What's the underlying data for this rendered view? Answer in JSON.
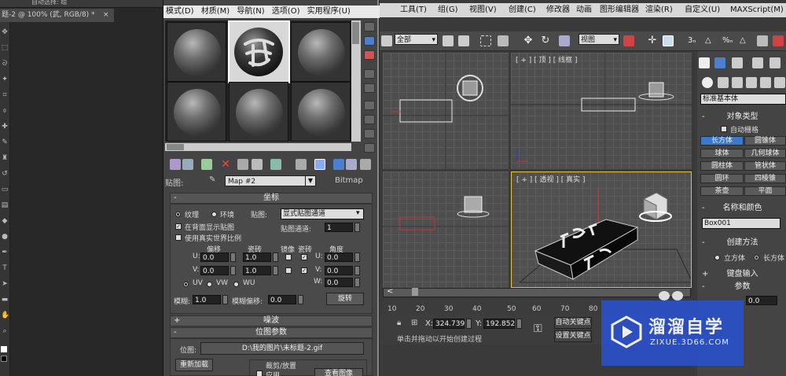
{
  "photoshop": {
    "top_text": "自动选择:  组",
    "tab_title": "题-2 @ 100% (武, RGB/8) *",
    "tab_close": "×"
  },
  "material_editor": {
    "menu": [
      "模式(D)",
      "材质(M)",
      "导航(N)",
      "选项(O)",
      "实用程序(U)"
    ],
    "map_label": "贴图:",
    "map_name": "Map #2",
    "map_type": "Bitmap",
    "rollout_coords": "坐标",
    "texture_label": "纹理",
    "environ_label": "环境",
    "mapping_label": "贴图:",
    "mapping_value": "显式贴图通道",
    "show_map_on_back": "在背面显示贴图",
    "map_channel_label": "贴图通道:",
    "map_channel_value": "1",
    "real_world_scale": "使用真实世界比例",
    "col_offset": "偏移",
    "col_tiling": "瓷砖",
    "col_mirror": "镜像",
    "col_tile": "瓷砖",
    "col_angle": "角度",
    "u_label": "U:",
    "v_label": "V:",
    "w_label": "W:",
    "u_offset": "0.0",
    "v_offset": "0.0",
    "u_tiling": "1.0",
    "v_tiling": "1.0",
    "u_angle": "0.0",
    "v_angle": "0.0",
    "w_angle": "0.0",
    "uv_label": "UV",
    "vw_label": "VW",
    "wu_label": "WU",
    "blur_label": "模糊:",
    "blur_value": "1.0",
    "blur_offset_label": "模糊偏移:",
    "blur_offset_value": "0.0",
    "rotate_button": "旋转",
    "rollout_noise": "噪波",
    "rollout_bitmap": "位图参数",
    "bitmap_label": "位图:",
    "bitmap_path": "D:\\我的图片\\未标题-2.gif",
    "reload_button": "重新加载",
    "crop_label": "裁剪/放置",
    "apply_label": "应用",
    "view_image": "查看图像"
  },
  "max": {
    "menu": [
      "工具(T)",
      "组(G)",
      "视图(V)",
      "创建(C)",
      "修改器",
      "动画",
      "图形编辑器",
      "渲染(R)",
      "自定义(U)",
      "MAXScript(M)"
    ],
    "selection_filter": "全部",
    "ref_coord": "视图",
    "viewports": {
      "top_label": "[ + ] [ 顶 ] [ 线框 ]",
      "persp_label": "[ + ] [ 透视 ] [ 真实 ]"
    },
    "timeline_frame": "<",
    "timeline_ticks": [
      "10",
      "20",
      "30",
      "40",
      "50",
      "60",
      "70",
      "80"
    ],
    "x_label": "X:",
    "x_value": "324.739",
    "y_label": "Y:",
    "y_value": "192.852",
    "auto_key": "自动关键点",
    "set_key": "设置关键点",
    "status_text": "单击并拖动以开始创建过程",
    "command_panel": {
      "category": "标准基本体",
      "object_type": "对象类型",
      "auto_grid": "自动栅格",
      "buttons": [
        "长方体",
        "圆锥体",
        "球体",
        "几何球体",
        "圆柱体",
        "管状体",
        "圆环",
        "四棱锥",
        "茶壶",
        "平面"
      ],
      "name_color": "名称和颜色",
      "object_name": "Box001",
      "creation_method": "创建方法",
      "cube": "立方体",
      "box": "长方体",
      "keyboard_entry": "键盘输入",
      "params": "参数",
      "param_value": "0.0"
    }
  },
  "watermark": {
    "brand": "溜溜自学",
    "url": "ZIXUE.3D66.COM"
  },
  "colors": {
    "accent_blue": "#3d79c9",
    "watermark_blue": "#2b50c9",
    "viewport_frame": "#e0c040"
  }
}
